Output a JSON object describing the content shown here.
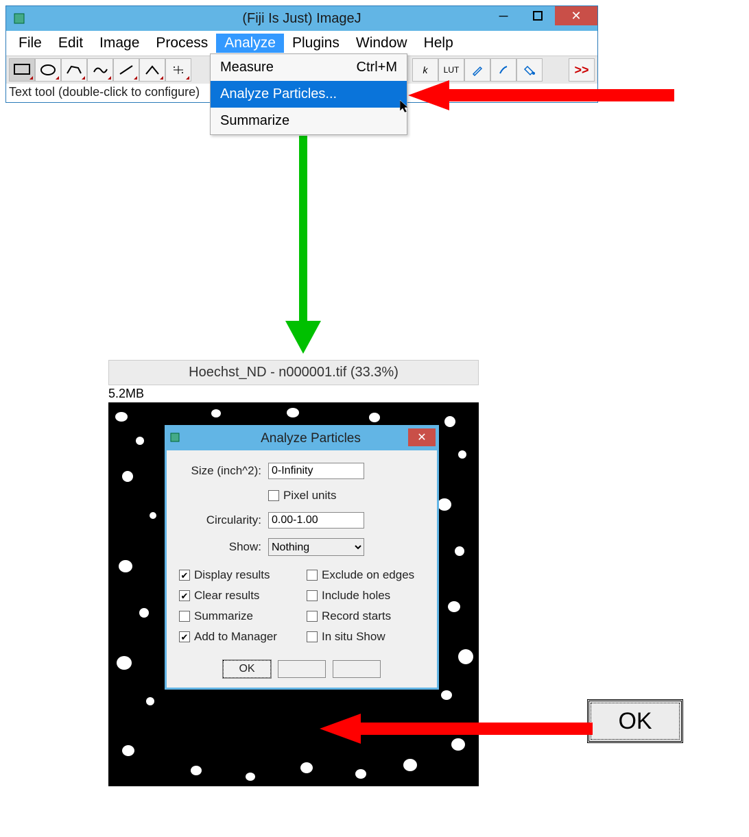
{
  "imagej": {
    "title": "(Fiji Is Just) ImageJ",
    "menus": [
      "File",
      "Edit",
      "Image",
      "Process",
      "Analyze",
      "Plugins",
      "Window",
      "Help"
    ],
    "active_menu_index": 4,
    "dropdown": {
      "items": [
        {
          "label": "Measure",
          "shortcut": "Ctrl+M"
        },
        {
          "label": "Analyze Particles..."
        },
        {
          "label": "Summarize"
        }
      ],
      "selected_index": 1
    },
    "status": "Text tool (double-click to configure)",
    "lut_label": "LUT"
  },
  "image_window": {
    "title": "Hoechst_ND - n000001.tif (33.3%)",
    "size_text": "5.2MB"
  },
  "dialog": {
    "title": "Analyze Particles",
    "fields": {
      "size_label": "Size (inch^2):",
      "size_value": "0-Infinity",
      "pixel_units_label": "Pixel units",
      "pixel_units_checked": false,
      "circularity_label": "Circularity:",
      "circularity_value": "0.00-1.00",
      "show_label": "Show:",
      "show_value": "Nothing"
    },
    "checks": [
      {
        "label": "Display results",
        "checked": true
      },
      {
        "label": "Exclude on edges",
        "checked": false
      },
      {
        "label": "Clear results",
        "checked": true
      },
      {
        "label": "Include holes",
        "checked": false
      },
      {
        "label": "Summarize",
        "checked": false
      },
      {
        "label": "Record starts",
        "checked": false
      },
      {
        "label": "Add to Manager",
        "checked": true
      },
      {
        "label": "In situ Show",
        "checked": false
      }
    ],
    "buttons": {
      "ok": "OK"
    }
  },
  "callout": {
    "ok": "OK"
  }
}
